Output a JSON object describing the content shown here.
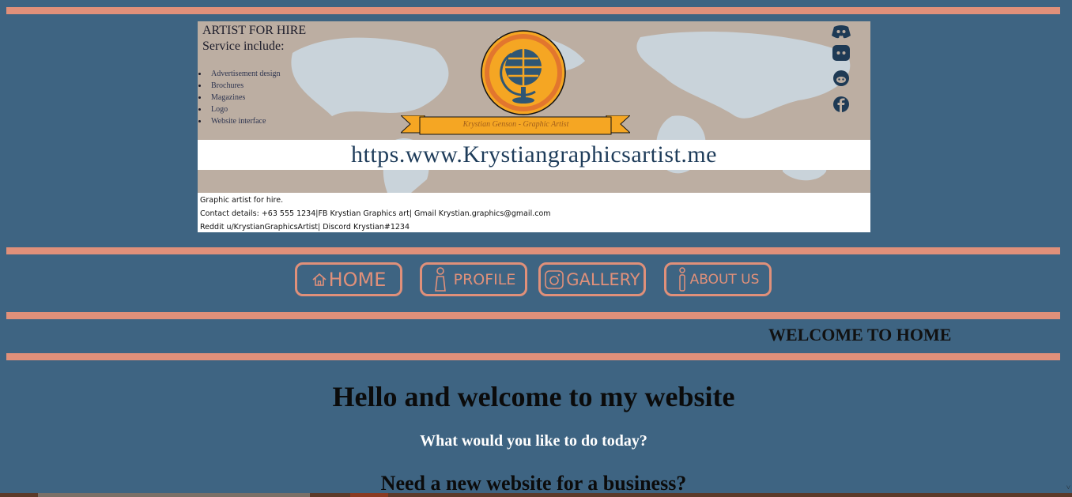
{
  "banner": {
    "title": "ARTIST FOR HIRE",
    "subtitle": "Service include:",
    "services": [
      "Advertisement design",
      "Brochures",
      "Magazines",
      "Logo",
      "Website interface"
    ],
    "ribbon_text": "Krystian Genson - Graphic Artist",
    "url": "https.www.Krystiangraphicsartist.me",
    "contact_lines": [
      "Graphic artist for hire.",
      "Contact details: +63 555 1234|FB Krystian Graphics art| Gmail Krystian.graphics@gmail.com",
      "Reddit u/KrystianGraphicsArtist| Discord Krystian#1234"
    ],
    "social_icons": [
      "discord-icon",
      "discord-square-icon",
      "reddit-icon",
      "facebook-icon"
    ]
  },
  "nav": {
    "items": [
      {
        "label": "HOME",
        "icon": "home-icon"
      },
      {
        "label": "PROFILE",
        "icon": "person-icon"
      },
      {
        "label": "GALLERY",
        "icon": "instagram-icon"
      },
      {
        "label": "ABOUT US",
        "icon": "info-icon"
      }
    ]
  },
  "section_title": "WELCOME TO HOME",
  "main": {
    "heading": "Hello and welcome to my website",
    "subheading": "What would you like to do today?",
    "question": "Need a new website for a business?"
  },
  "colors": {
    "background": "#3e6482",
    "accent": "#e0907a",
    "globe_orange": "#f5a623",
    "url_text": "#1e3c5a"
  }
}
